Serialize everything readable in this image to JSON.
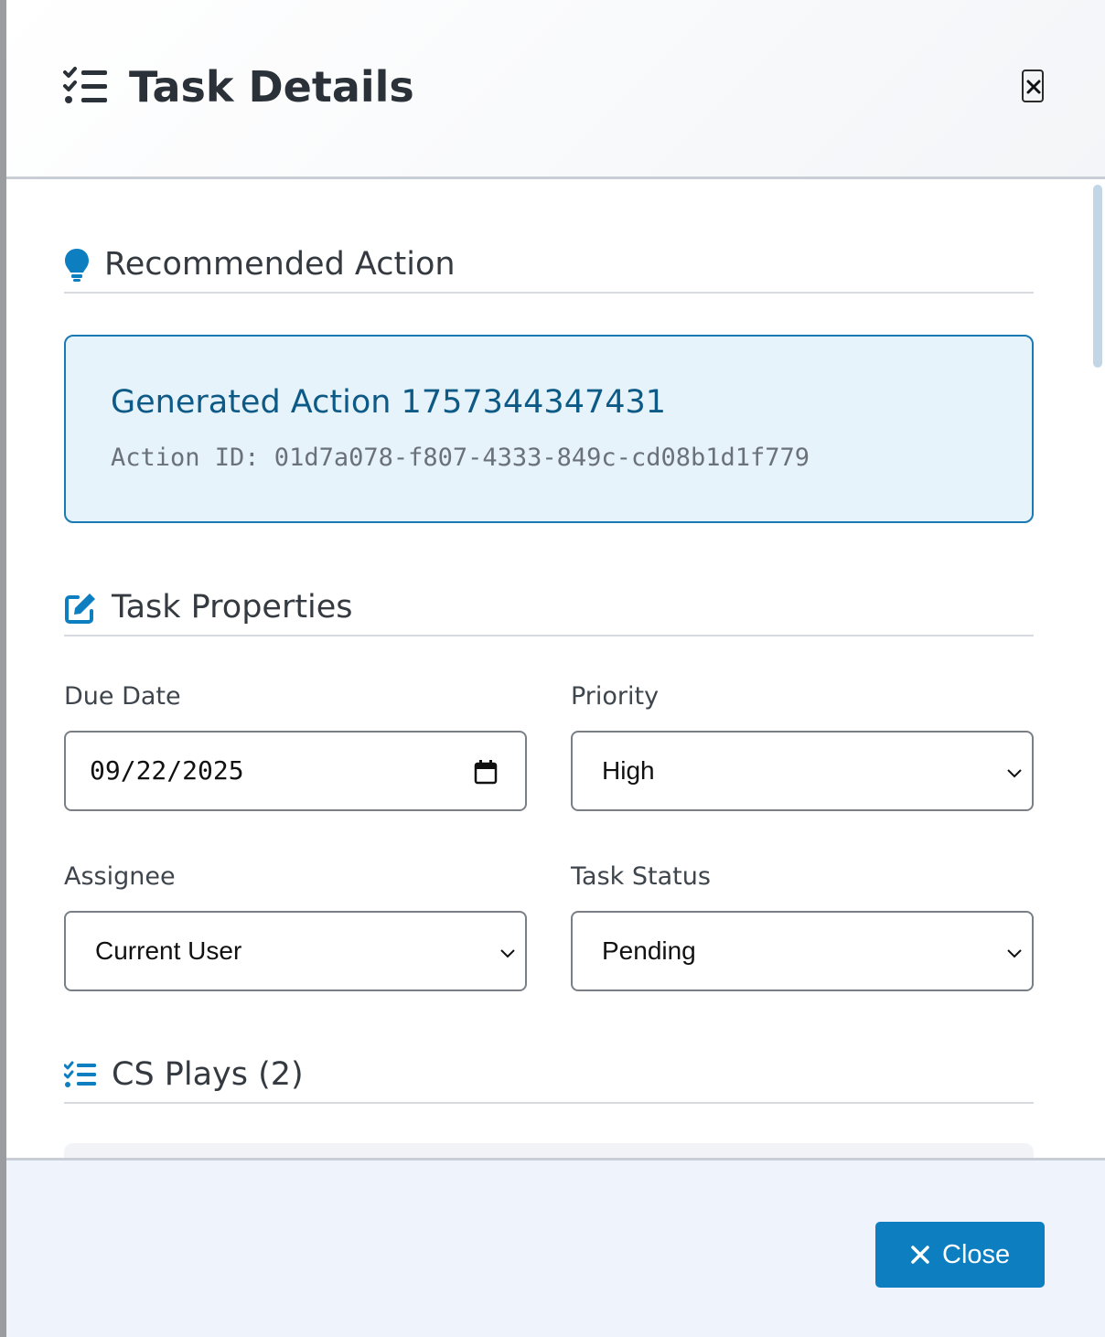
{
  "modal": {
    "title": "Task Details",
    "close_x_label": "×"
  },
  "recommended_action": {
    "section_title": "Recommended Action",
    "action_title": "Generated Action 1757344347431",
    "action_id": "Action ID: 01d7a078-f807-4333-849c-cd08b1d1f779"
  },
  "task_properties": {
    "section_title": "Task Properties",
    "due_date": {
      "label": "Due Date",
      "value": "09/22/2025"
    },
    "priority": {
      "label": "Priority",
      "value": "High"
    },
    "assignee": {
      "label": "Assignee",
      "value": "Current User"
    },
    "task_status": {
      "label": "Task Status",
      "value": "Pending"
    }
  },
  "cs_plays": {
    "section_title": "CS Plays (2)"
  },
  "footer": {
    "close_label": "Close"
  },
  "colors": {
    "accent": "#0d7fc0",
    "action_title": "#0d5a87",
    "card_bg": "#e6f3fa",
    "card_border": "#1b7ab3",
    "text_dark": "#343a40"
  },
  "icons": {
    "header": "tasks-checklist-icon",
    "recommended": "lightbulb-icon",
    "properties": "edit-icon",
    "plays": "tasks-checklist-icon",
    "close": "close-icon"
  }
}
